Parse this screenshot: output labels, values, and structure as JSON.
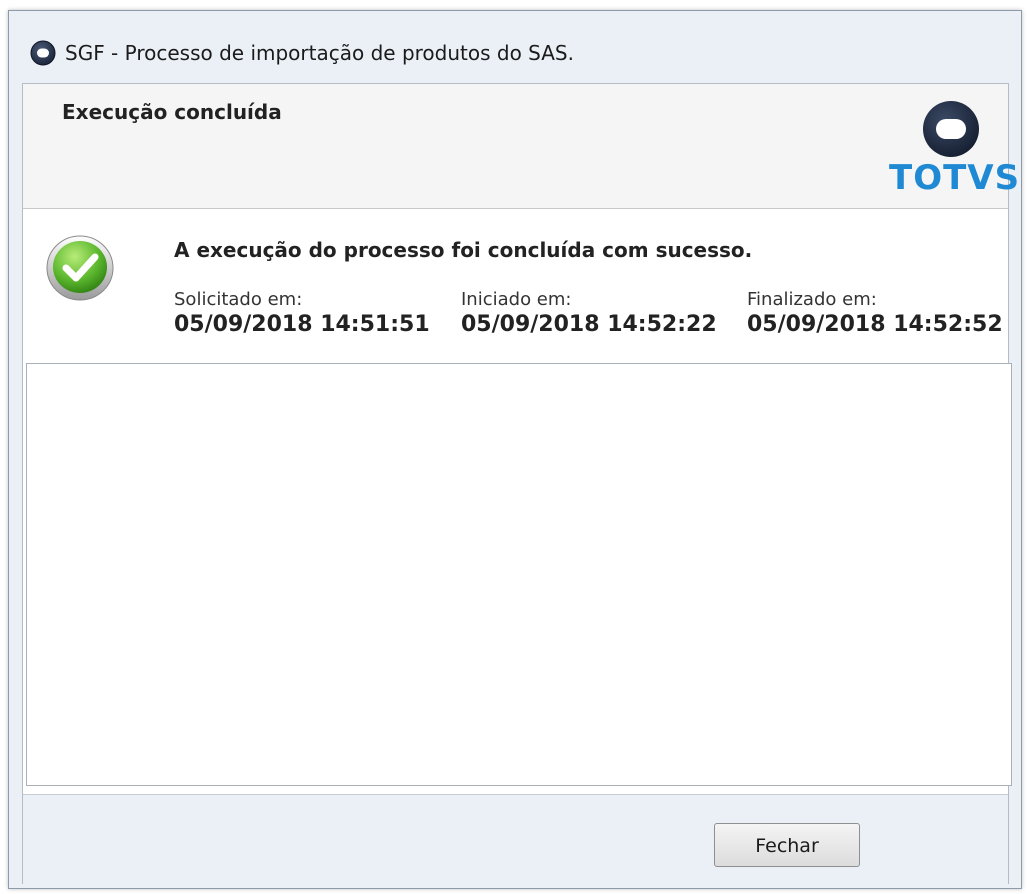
{
  "window": {
    "title": "SGF - Processo de importação de produtos do SAS."
  },
  "header": {
    "title": "Execução concluída",
    "logo_text": "TOTVS"
  },
  "status": {
    "message": "A execução do processo foi concluída com sucesso.",
    "icon": "success-check-icon"
  },
  "times": {
    "requested": {
      "label": "Solicitado em:",
      "value": "05/09/2018 14:51:51"
    },
    "started": {
      "label": "Iniciado em:",
      "value": "05/09/2018 14:52:22"
    },
    "finished": {
      "label": "Finalizado em:",
      "value": "05/09/2018 14:52:52"
    }
  },
  "footer": {
    "close_label": "Fechar"
  },
  "colors": {
    "brand": "#1f8ad3",
    "window_bg": "#ebf0f6",
    "success": "#5cb82e"
  }
}
